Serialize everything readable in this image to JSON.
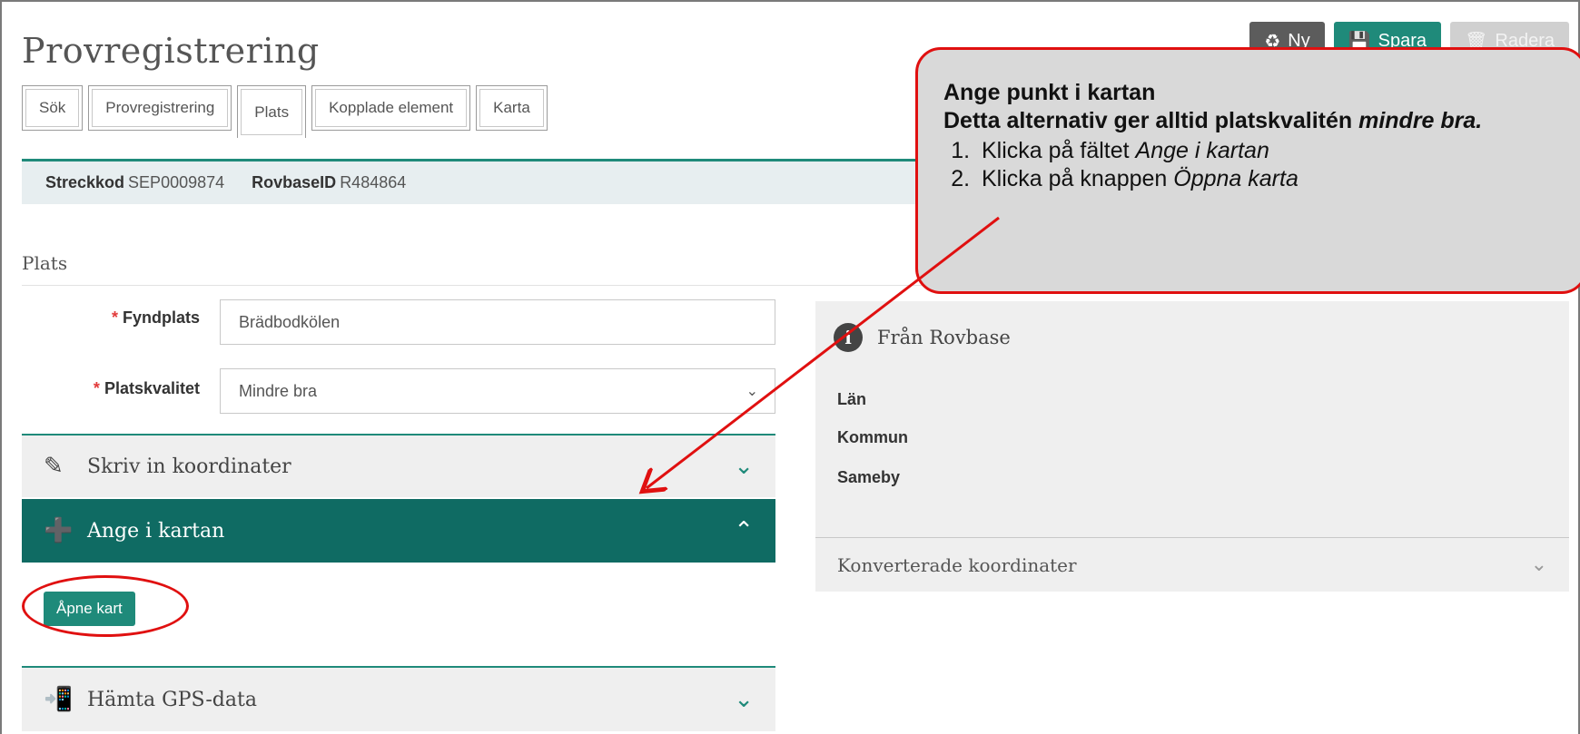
{
  "page": {
    "title": "Provregistrering"
  },
  "toolbar": {
    "ny_label": "Ny",
    "spara_label": "Spara",
    "radera_label": "Radera"
  },
  "tabs": [
    {
      "label": "Sök"
    },
    {
      "label": "Provregistrering"
    },
    {
      "label": "Plats",
      "active": true
    },
    {
      "label": "Kopplade element"
    },
    {
      "label": "Karta"
    }
  ],
  "ids": {
    "streckkod_label": "Streckkod",
    "streckkod_value": "SEP0009874",
    "rovbase_label": "RovbaseID",
    "rovbase_value": "R484864"
  },
  "section": {
    "label": "Plats"
  },
  "form": {
    "fyndplats": {
      "label": "Fyndplats",
      "required": "*",
      "value": "Brädbodkölen"
    },
    "platskvalitet": {
      "label": "Platskvalitet",
      "required": "*",
      "value": "Mindre bra"
    }
  },
  "accordions": {
    "skriv": {
      "label": "Skriv in koordinater",
      "state": "collapsed"
    },
    "ange": {
      "label": "Ange i kartan",
      "state": "expanded"
    },
    "gps": {
      "label": "Hämta GPS-data",
      "state": "collapsed"
    }
  },
  "open_map_button": {
    "label": "Åpne kart"
  },
  "rovbase_panel": {
    "title": "Från Rovbase",
    "rows": [
      "Län",
      "Kommun",
      "Sameby"
    ]
  },
  "converted": {
    "label": "Konverterade koordinater"
  },
  "callout": {
    "title": "Ange punkt i kartan",
    "line2_prefix": "Detta alternativ ger alltid platskvalitén",
    "line2_emph": "mindre bra.",
    "steps": [
      {
        "prefix": "Klicka på fältet",
        "emph": "Ange i kartan"
      },
      {
        "prefix": "Klicka på knappen",
        "emph": "Öppna karta"
      }
    ]
  },
  "colors": {
    "teal": "#1f8a7a",
    "dark_teal": "#0f6b63",
    "annotation_red": "#e01010",
    "required_red": "#e23b3b"
  }
}
